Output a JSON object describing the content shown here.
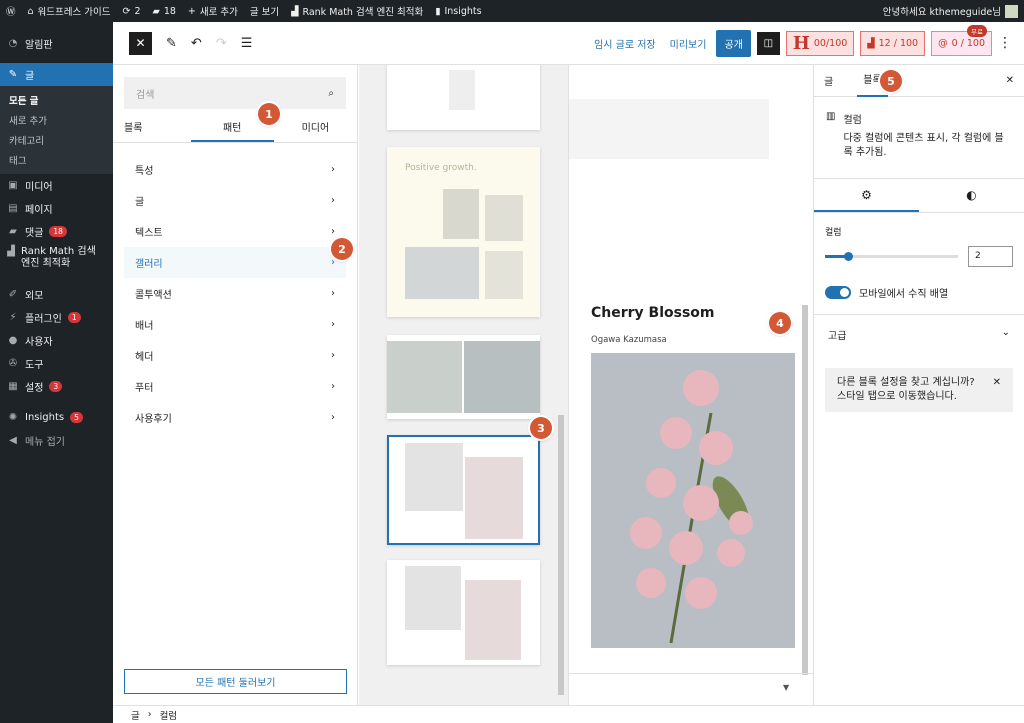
{
  "adminbar": {
    "site": "워드프레스 가이드",
    "updates": "2",
    "comments": "18",
    "new": "새로 추가",
    "view": "글 보기",
    "rankmath": "Rank Math 검색 엔진 최적화",
    "insights": "Insights",
    "greeting": "안녕하세요 kthemeguide님"
  },
  "sidebar": {
    "dashboard": "알림판",
    "posts": "글",
    "sub": [
      "모든 글",
      "새로 추가",
      "카테고리",
      "태그"
    ],
    "media": "미디어",
    "pages": "페이지",
    "comments": "댓글",
    "comments_badge": "18",
    "rankmath": "Rank Math 검색 엔진 최적화",
    "appearance": "외모",
    "plugins": "플러그인",
    "plugins_badge": "1",
    "users": "사용자",
    "tools": "도구",
    "settings": "설정",
    "settings_badge": "3",
    "insights": "Insights",
    "insights_badge": "5",
    "collapse": "메뉴 접기"
  },
  "topbar": {
    "save_draft": "임시 글로 저장",
    "preview": "미리보기",
    "publish": "공개",
    "score_h": "00/100",
    "score_rm": "12 / 100",
    "score_c": "0 / 100",
    "free": "무료"
  },
  "inserter": {
    "search_placeholder": "검색",
    "tabs": [
      "블록",
      "패턴",
      "미디어"
    ],
    "categories": [
      "특성",
      "글",
      "텍스트",
      "갤러리",
      "콜투액션",
      "배너",
      "헤더",
      "푸터",
      "사용후기"
    ],
    "explore": "모든 패턴 둘러보기"
  },
  "patterns": {
    "heading": "Positive growth."
  },
  "canvas": {
    "title": "Cherry Blossom",
    "author": "Ogawa Kazumasa"
  },
  "settings": {
    "tabs": [
      "글",
      "블록"
    ],
    "block_name": "컬럼",
    "block_desc": "다중 컬럼에 콘텐츠 표시, 각 컬럼에 블록 추가됨.",
    "columns_label": "컬럼",
    "columns_value": "2",
    "columns_slider_fraction": 0.17,
    "stack_mobile": "모바일에서 수직 배열",
    "stack_on": true,
    "advanced": "고급",
    "notice": "다른 블록 설정을 찾고 계십니까? 스타일 탭으로 이동했습니다."
  },
  "markers": [
    "1",
    "2",
    "3",
    "4",
    "5"
  ],
  "footer": {
    "crumbs": [
      "글",
      "컬럼"
    ]
  },
  "colors": {
    "accent": "#2271b1",
    "admin": "#1d2327",
    "marker": "#d35836"
  }
}
